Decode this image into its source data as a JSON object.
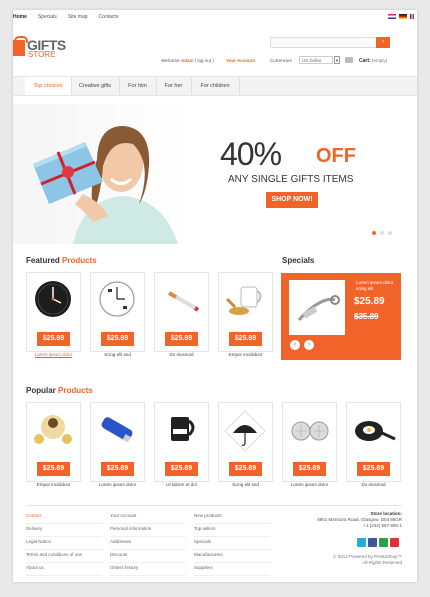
{
  "topnav": [
    "Home",
    "Specials",
    "Site map",
    "Contacts"
  ],
  "logo": {
    "line1": "GIFTS",
    "line2": "STORE"
  },
  "search": {
    "button": "›"
  },
  "account": {
    "welcome": "Welcome",
    "user": "Adam",
    "logout": "( log out )",
    "my_account": "Your Account",
    "currencies_label": "Currencies",
    "currency_value": "US Dollar",
    "currency_arrow": "▼",
    "cart_label": "Cart:",
    "cart_state": "(empty)"
  },
  "menu": [
    "Top choices",
    "Creative gifts",
    "For him",
    "For her",
    "For children"
  ],
  "banner": {
    "percent": "40%",
    "off": "OFF",
    "subtitle": "ANY SINGLE GIFTS ITEMS",
    "button": "SHOP NOW!"
  },
  "featured": {
    "title_a": "Featured",
    "title_b": "Products",
    "items": [
      {
        "price": "$25.89",
        "name": "Lorem ipsum dolor",
        "link": true
      },
      {
        "price": "$25.89",
        "name": "Scing elit sed",
        "link": false
      },
      {
        "price": "$25.89",
        "name": "Do eiusmod",
        "link": false
      },
      {
        "price": "$25.89",
        "name": "Empor incididunt",
        "link": false
      }
    ]
  },
  "specials": {
    "title": "Specials",
    "name": "Lorem ipsum dolor scing elit",
    "price": "$25.89",
    "old_price": "$35.89",
    "prev": "‹",
    "next": "›"
  },
  "popular": {
    "title_a": "Popular",
    "title_b": "Products",
    "items": [
      {
        "price": "$25.89",
        "name": "Empor incididunt"
      },
      {
        "price": "$25.89",
        "name": "Lorem ipsum dolor"
      },
      {
        "price": "$25.89",
        "name": "Ut labore et dol"
      },
      {
        "price": "$25.89",
        "name": "Scing elit sed"
      },
      {
        "price": "$25.89",
        "name": "Lorem ipsum dolor"
      },
      {
        "price": "$25.89",
        "name": "Do eiusmod"
      }
    ]
  },
  "footer": {
    "col1": [
      "Contact",
      "Delivery",
      "Legal Notice",
      "Terms and conditions of use",
      "About us"
    ],
    "col2": [
      "Your Account",
      "Personal information",
      "Addresses",
      "Discount",
      "Orders history"
    ],
    "col3": [
      "New products",
      "Top sellers",
      "Specials",
      "Manufacturers",
      "Suppliers"
    ],
    "store_title": "Store location:",
    "address": "8901 Marmora Road, Glasgow, D04 89GR",
    "phone": "+1 (234) 567-890-1",
    "copyright": "© 2012 Powered by PrestaShop™",
    "rights": "All Rights Reserved"
  },
  "colors": {
    "accent": "#f0642a"
  }
}
